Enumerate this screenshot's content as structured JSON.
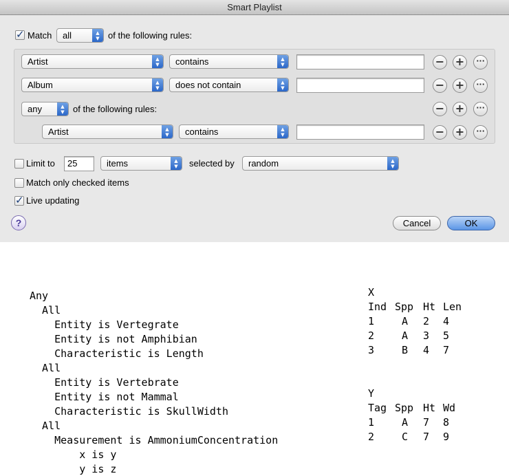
{
  "window": {
    "title": "Smart Playlist"
  },
  "match": {
    "checked": true,
    "label": "Match",
    "quantifier": "all",
    "suffix": "of the following rules:"
  },
  "rules": [
    {
      "field": "Artist",
      "operator": "contains",
      "value": ""
    },
    {
      "field": "Album",
      "operator": "does not contain",
      "value": ""
    }
  ],
  "nested": {
    "quantifier": "any",
    "suffix": "of the following rules:",
    "rule": {
      "field": "Artist",
      "operator": "contains",
      "value": ""
    }
  },
  "rule_buttons": {
    "remove": "−",
    "add": "+",
    "more": "···"
  },
  "limit": {
    "checked": false,
    "label": "Limit to",
    "value": "25",
    "unit": "items",
    "selected_by_label": "selected by",
    "selected_by": "random"
  },
  "match_checked": {
    "checked": false,
    "label": "Match only checked items"
  },
  "live_updating": {
    "checked": true,
    "label": "Live updating"
  },
  "help": {
    "label": "?"
  },
  "buttons": {
    "cancel": "Cancel",
    "ok": "OK"
  },
  "colors": {
    "accent": "#2b67c9",
    "window_bg": "#e8e8e8",
    "check_mark": "#1d3f7a"
  },
  "query_text": {
    "lines": [
      "Any",
      "  All",
      "    Entity is Vertegrate",
      "    Entity is not Amphibian",
      "    Characteristic is Length",
      "  All",
      "    Entity is Vertebrate",
      "    Entity is not Mammal",
      "    Characteristic is SkullWidth",
      "  All",
      "    Measurement is AmmoniumConcentration",
      "        x is y",
      "        y is z"
    ]
  },
  "table_x": {
    "name": "X",
    "headers": [
      "Ind",
      "Spp",
      "Ht",
      "Len"
    ],
    "rows": [
      [
        "1",
        "A",
        "2",
        "4"
      ],
      [
        "2",
        "A",
        "3",
        "5"
      ],
      [
        "3",
        "B",
        "4",
        "7"
      ]
    ]
  },
  "table_y": {
    "name": "Y",
    "headers": [
      "Tag",
      "Spp",
      "Ht",
      "Wd"
    ],
    "rows": [
      [
        "1",
        "A",
        "7",
        "8"
      ],
      [
        "2",
        "C",
        "7",
        "9"
      ]
    ]
  }
}
